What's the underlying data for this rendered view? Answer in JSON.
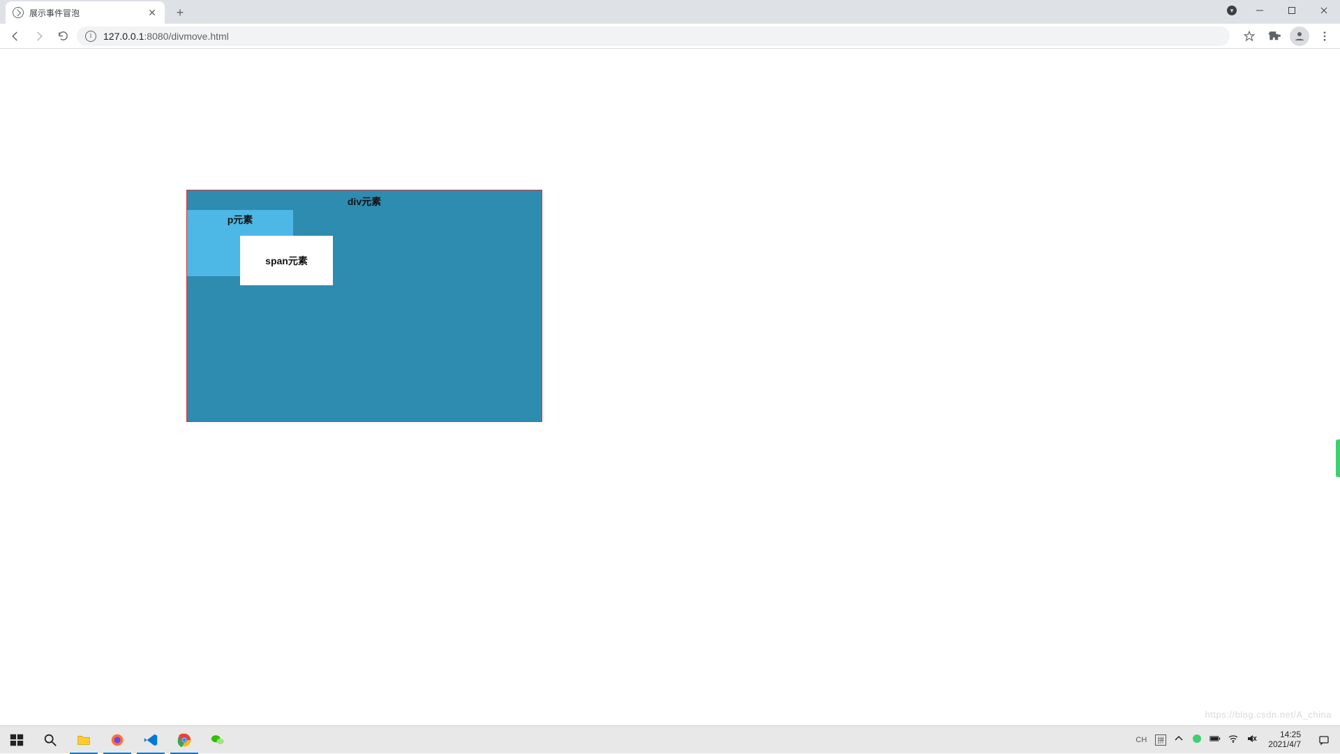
{
  "browser": {
    "tab_title": "展示事件冒泡",
    "new_tab_tooltip": "+",
    "url_host": "127.0.0.1",
    "url_port": ":8080",
    "url_path": "/divmove.html",
    "info_glyph": "i"
  },
  "window_controls": {
    "account_menu": "▾"
  },
  "page": {
    "div_label": "div元素",
    "p_label": "p元素",
    "span_label": "span元素",
    "watermark": "https://blog.csdn.net/A_china"
  },
  "taskbar": {
    "ime_lang": "CH",
    "ime_mode": "拼",
    "time": "14:25",
    "date": "2021/4/7"
  },
  "colors": {
    "div_bg": "#2d8cb0",
    "div_border": "#e03030",
    "p_bg": "#4db8e6",
    "span_bg": "#ffffff"
  }
}
